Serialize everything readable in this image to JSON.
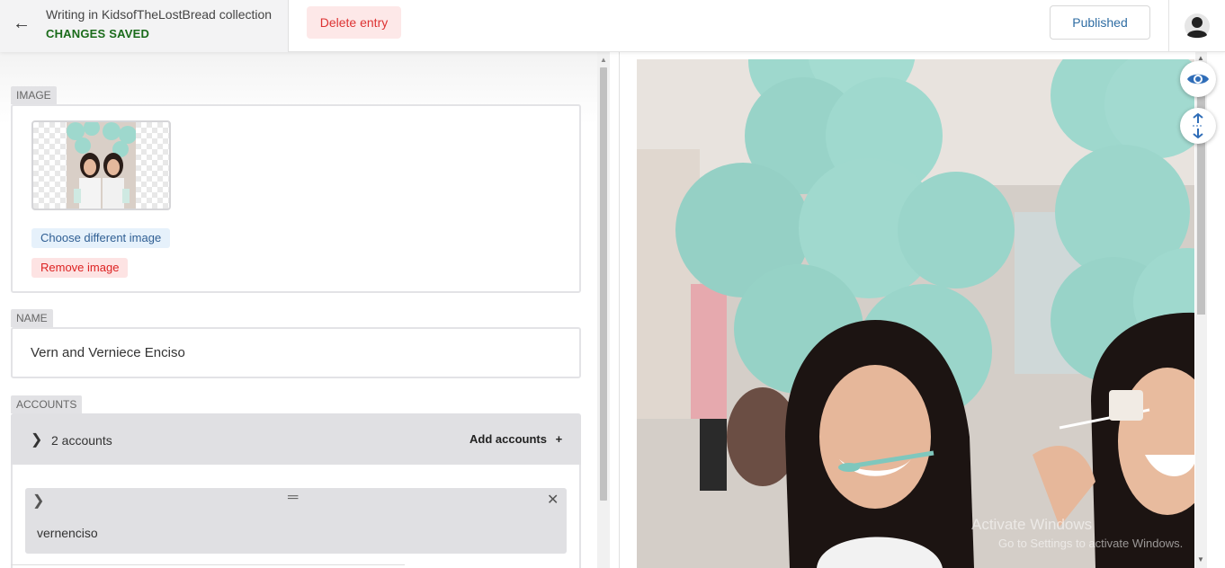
{
  "header": {
    "back_icon": "arrow-left-icon",
    "breadcrumb": "Writing in KidsofTheLostBread collection",
    "save_status": "CHANGES SAVED",
    "delete_label": "Delete entry",
    "published_label": "Published",
    "avatar_icon": "user-avatar-icon"
  },
  "form": {
    "image": {
      "label": "IMAGE",
      "choose_label": "Choose different image",
      "remove_label": "Remove image"
    },
    "name": {
      "label": "NAME",
      "value": "Vern and Verniece Enciso"
    },
    "accounts": {
      "label": "ACCOUNTS",
      "summary": "2 accounts",
      "add_label": "Add accounts",
      "add_icon": "plus-icon",
      "items": [
        {
          "value": "vernenciso"
        }
      ]
    }
  },
  "preview": {
    "eye_icon": "eye-icon",
    "expand_icon": "vertical-expand-icon",
    "watermark_line1": "Activate Windows",
    "watermark_line2": "Go to Settings to activate Windows."
  },
  "colors": {
    "saved_green": "#1a6b1a",
    "delete_red": "#d33333",
    "published_blue": "#2f6da3",
    "balloon_teal": "#9ed8cd"
  }
}
